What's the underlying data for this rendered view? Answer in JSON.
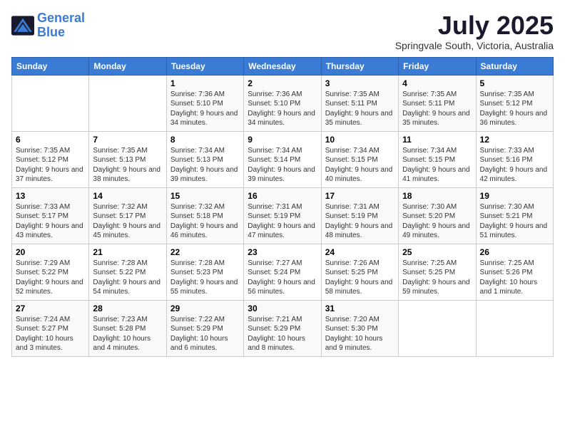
{
  "logo": {
    "line1": "General",
    "line2": "Blue"
  },
  "title": "July 2025",
  "location": "Springvale South, Victoria, Australia",
  "weekdays": [
    "Sunday",
    "Monday",
    "Tuesday",
    "Wednesday",
    "Thursday",
    "Friday",
    "Saturday"
  ],
  "weeks": [
    [
      {
        "day": null
      },
      {
        "day": null
      },
      {
        "day": "1",
        "sunrise": "Sunrise: 7:36 AM",
        "sunset": "Sunset: 5:10 PM",
        "daylight": "Daylight: 9 hours and 34 minutes."
      },
      {
        "day": "2",
        "sunrise": "Sunrise: 7:36 AM",
        "sunset": "Sunset: 5:10 PM",
        "daylight": "Daylight: 9 hours and 34 minutes."
      },
      {
        "day": "3",
        "sunrise": "Sunrise: 7:35 AM",
        "sunset": "Sunset: 5:11 PM",
        "daylight": "Daylight: 9 hours and 35 minutes."
      },
      {
        "day": "4",
        "sunrise": "Sunrise: 7:35 AM",
        "sunset": "Sunset: 5:11 PM",
        "daylight": "Daylight: 9 hours and 35 minutes."
      },
      {
        "day": "5",
        "sunrise": "Sunrise: 7:35 AM",
        "sunset": "Sunset: 5:12 PM",
        "daylight": "Daylight: 9 hours and 36 minutes."
      }
    ],
    [
      {
        "day": "6",
        "sunrise": "Sunrise: 7:35 AM",
        "sunset": "Sunset: 5:12 PM",
        "daylight": "Daylight: 9 hours and 37 minutes."
      },
      {
        "day": "7",
        "sunrise": "Sunrise: 7:35 AM",
        "sunset": "Sunset: 5:13 PM",
        "daylight": "Daylight: 9 hours and 38 minutes."
      },
      {
        "day": "8",
        "sunrise": "Sunrise: 7:34 AM",
        "sunset": "Sunset: 5:13 PM",
        "daylight": "Daylight: 9 hours and 39 minutes."
      },
      {
        "day": "9",
        "sunrise": "Sunrise: 7:34 AM",
        "sunset": "Sunset: 5:14 PM",
        "daylight": "Daylight: 9 hours and 39 minutes."
      },
      {
        "day": "10",
        "sunrise": "Sunrise: 7:34 AM",
        "sunset": "Sunset: 5:15 PM",
        "daylight": "Daylight: 9 hours and 40 minutes."
      },
      {
        "day": "11",
        "sunrise": "Sunrise: 7:34 AM",
        "sunset": "Sunset: 5:15 PM",
        "daylight": "Daylight: 9 hours and 41 minutes."
      },
      {
        "day": "12",
        "sunrise": "Sunrise: 7:33 AM",
        "sunset": "Sunset: 5:16 PM",
        "daylight": "Daylight: 9 hours and 42 minutes."
      }
    ],
    [
      {
        "day": "13",
        "sunrise": "Sunrise: 7:33 AM",
        "sunset": "Sunset: 5:17 PM",
        "daylight": "Daylight: 9 hours and 43 minutes."
      },
      {
        "day": "14",
        "sunrise": "Sunrise: 7:32 AM",
        "sunset": "Sunset: 5:17 PM",
        "daylight": "Daylight: 9 hours and 45 minutes."
      },
      {
        "day": "15",
        "sunrise": "Sunrise: 7:32 AM",
        "sunset": "Sunset: 5:18 PM",
        "daylight": "Daylight: 9 hours and 46 minutes."
      },
      {
        "day": "16",
        "sunrise": "Sunrise: 7:31 AM",
        "sunset": "Sunset: 5:19 PM",
        "daylight": "Daylight: 9 hours and 47 minutes."
      },
      {
        "day": "17",
        "sunrise": "Sunrise: 7:31 AM",
        "sunset": "Sunset: 5:19 PM",
        "daylight": "Daylight: 9 hours and 48 minutes."
      },
      {
        "day": "18",
        "sunrise": "Sunrise: 7:30 AM",
        "sunset": "Sunset: 5:20 PM",
        "daylight": "Daylight: 9 hours and 49 minutes."
      },
      {
        "day": "19",
        "sunrise": "Sunrise: 7:30 AM",
        "sunset": "Sunset: 5:21 PM",
        "daylight": "Daylight: 9 hours and 51 minutes."
      }
    ],
    [
      {
        "day": "20",
        "sunrise": "Sunrise: 7:29 AM",
        "sunset": "Sunset: 5:22 PM",
        "daylight": "Daylight: 9 hours and 52 minutes."
      },
      {
        "day": "21",
        "sunrise": "Sunrise: 7:28 AM",
        "sunset": "Sunset: 5:22 PM",
        "daylight": "Daylight: 9 hours and 54 minutes."
      },
      {
        "day": "22",
        "sunrise": "Sunrise: 7:28 AM",
        "sunset": "Sunset: 5:23 PM",
        "daylight": "Daylight: 9 hours and 55 minutes."
      },
      {
        "day": "23",
        "sunrise": "Sunrise: 7:27 AM",
        "sunset": "Sunset: 5:24 PM",
        "daylight": "Daylight: 9 hours and 56 minutes."
      },
      {
        "day": "24",
        "sunrise": "Sunrise: 7:26 AM",
        "sunset": "Sunset: 5:25 PM",
        "daylight": "Daylight: 9 hours and 58 minutes."
      },
      {
        "day": "25",
        "sunrise": "Sunrise: 7:25 AM",
        "sunset": "Sunset: 5:25 PM",
        "daylight": "Daylight: 9 hours and 59 minutes."
      },
      {
        "day": "26",
        "sunrise": "Sunrise: 7:25 AM",
        "sunset": "Sunset: 5:26 PM",
        "daylight": "Daylight: 10 hours and 1 minute."
      }
    ],
    [
      {
        "day": "27",
        "sunrise": "Sunrise: 7:24 AM",
        "sunset": "Sunset: 5:27 PM",
        "daylight": "Daylight: 10 hours and 3 minutes."
      },
      {
        "day": "28",
        "sunrise": "Sunrise: 7:23 AM",
        "sunset": "Sunset: 5:28 PM",
        "daylight": "Daylight: 10 hours and 4 minutes."
      },
      {
        "day": "29",
        "sunrise": "Sunrise: 7:22 AM",
        "sunset": "Sunset: 5:29 PM",
        "daylight": "Daylight: 10 hours and 6 minutes."
      },
      {
        "day": "30",
        "sunrise": "Sunrise: 7:21 AM",
        "sunset": "Sunset: 5:29 PM",
        "daylight": "Daylight: 10 hours and 8 minutes."
      },
      {
        "day": "31",
        "sunrise": "Sunrise: 7:20 AM",
        "sunset": "Sunset: 5:30 PM",
        "daylight": "Daylight: 10 hours and 9 minutes."
      },
      {
        "day": null
      },
      {
        "day": null
      }
    ]
  ]
}
